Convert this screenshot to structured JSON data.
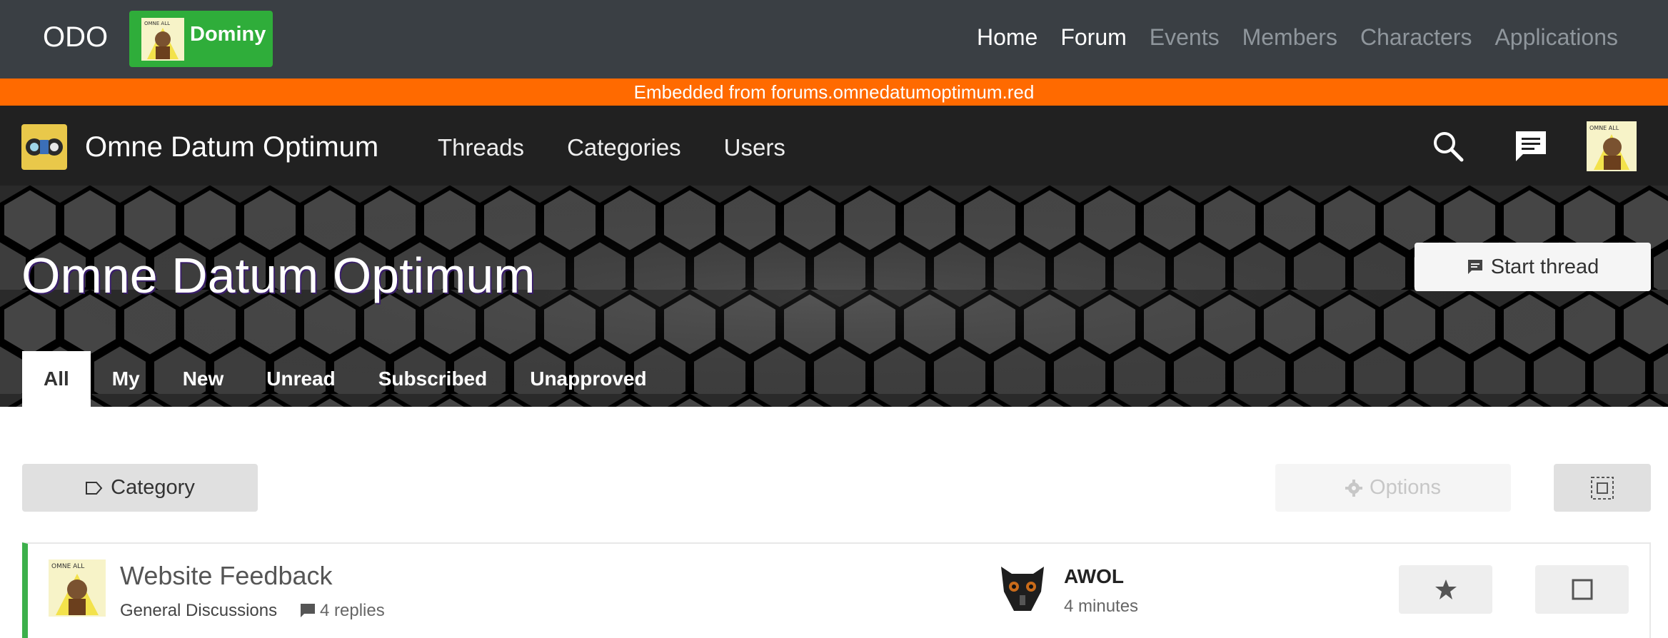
{
  "app": {
    "brand": "ODO",
    "user_name": "Dominy",
    "nav": [
      {
        "label": "Home",
        "active": true
      },
      {
        "label": "Forum",
        "active": true
      },
      {
        "label": "Events",
        "active": false
      },
      {
        "label": "Members",
        "active": false
      },
      {
        "label": "Characters",
        "active": false
      },
      {
        "label": "Applications",
        "active": false
      }
    ]
  },
  "embed_notice": "Embedded from forums.omnedatumoptimum.red",
  "forum": {
    "site_title": "Omne Datum Optimum",
    "nav": [
      "Threads",
      "Categories",
      "Users"
    ],
    "icons": {
      "search": "search-icon",
      "chat": "chat-icon"
    }
  },
  "hero": {
    "title": "Omne Datum Optimum",
    "start_thread_label": "Start thread",
    "tabs": [
      "All",
      "My",
      "New",
      "Unread",
      "Subscribed",
      "Unapproved"
    ],
    "active_tab": "All"
  },
  "toolbar": {
    "category_label": "Category",
    "options_label": "Options"
  },
  "threads": [
    {
      "title": "Website Feedback",
      "category": "General Discussions",
      "replies": "4 replies",
      "last_user": "AWOL",
      "last_time": "4 minutes"
    }
  ],
  "colors": {
    "topbar": "#3a3f44",
    "user_chip": "#2fad3a",
    "embed_banner": "#ff6a00",
    "forum_header": "#212121",
    "thread_accent": "#3cb04b"
  }
}
